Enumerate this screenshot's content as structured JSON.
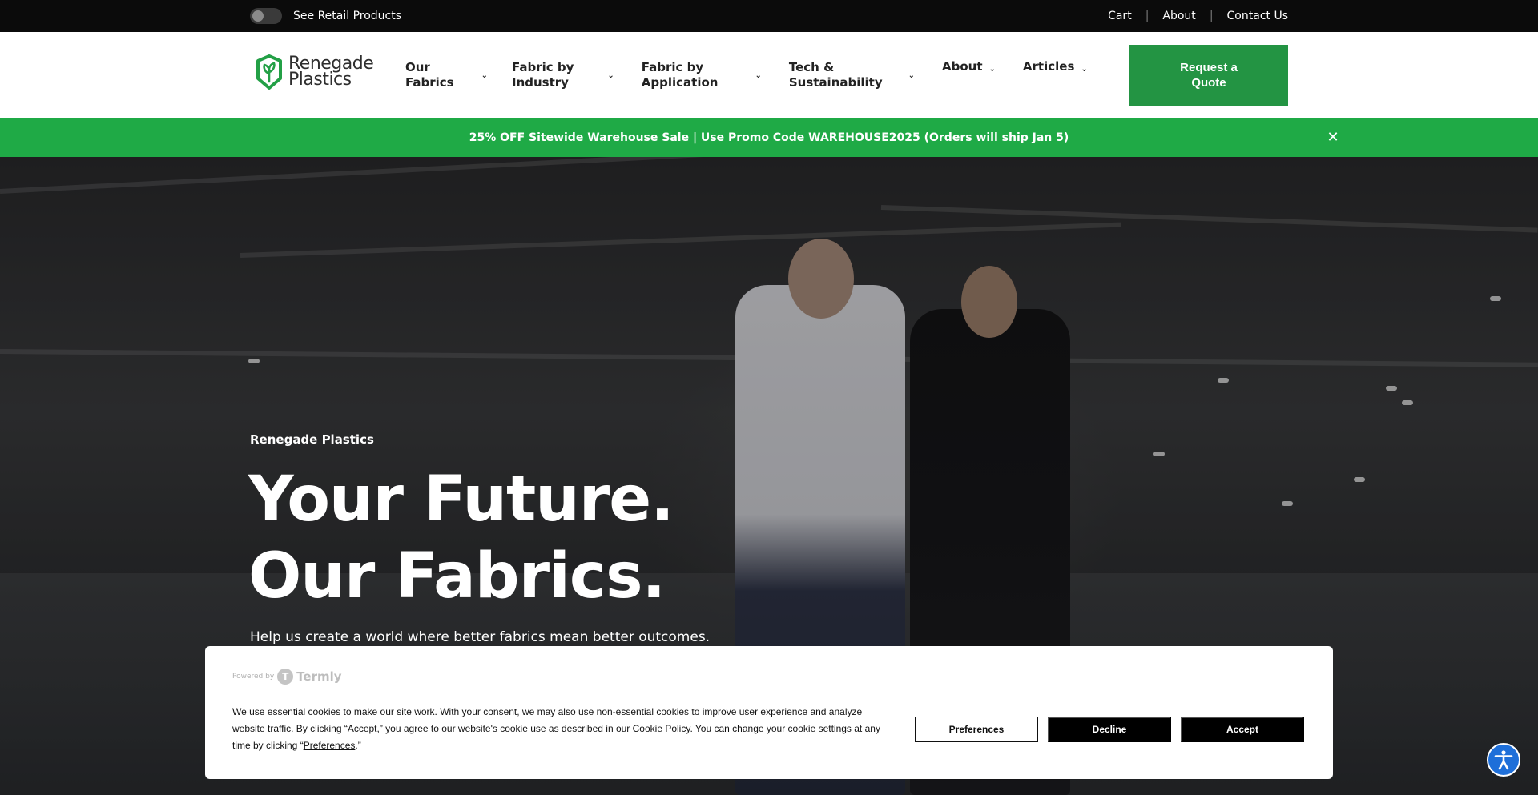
{
  "topbar": {
    "toggle_label": "See Retail Products",
    "links": [
      "Cart",
      "About",
      "Contact Us"
    ]
  },
  "header": {
    "logo_line1": "Renegade",
    "logo_line2": "Plastics",
    "nav": [
      {
        "label": "Our\nFabrics"
      },
      {
        "label": "Fabric by\nIndustry"
      },
      {
        "label": "Fabric by\nApplication"
      },
      {
        "label": "Tech &\nSustainability"
      },
      {
        "label": "About"
      },
      {
        "label": "Articles"
      }
    ],
    "cta_label": "Request a\nQuote"
  },
  "promo": {
    "text": "25% OFF Sitewide Warehouse Sale | Use Promo Code WAREHOUSE2025 (Orders will ship Jan 5)",
    "close_glyph": "✕"
  },
  "hero": {
    "eyebrow": "Renegade Plastics",
    "headline_line1": "Your Future.",
    "headline_line2": "Our Fabrics.",
    "subhead": "Help us create a world where better fabrics mean better outcomes."
  },
  "cookie": {
    "powered_by": "Powered by",
    "brand": "Termly",
    "text_1": "We use essential cookies to make our site work. With your consent, we may also use non-essential cookies to improve user experience and analyze website traffic. By clicking “Accept,” you agree to our website's cookie use as described in our ",
    "cookie_policy_link": "Cookie Policy",
    "text_2": ". You can change your cookie settings at any time by clicking “",
    "preferences_link": "Preferences",
    "text_3": ".”",
    "buttons": {
      "preferences": "Preferences",
      "decline": "Decline",
      "accept": "Accept"
    }
  },
  "colors": {
    "brand_green": "#239443",
    "promo_green": "#1faa46",
    "topbar_bg": "#0b0b0b",
    "a11y_blue": "#1e6fd9"
  },
  "icons": {
    "nav_chevron": "chevron-down-icon",
    "promo_close": "close-icon",
    "accessibility": "accessibility-icon"
  }
}
